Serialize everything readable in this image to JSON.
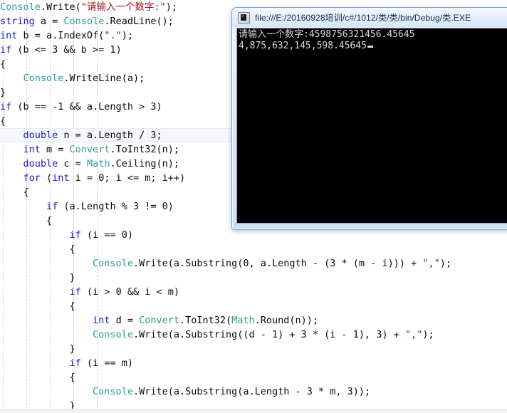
{
  "editor": {
    "name": "code-editor",
    "syntax_colors": {
      "keyword": "#1818d0",
      "type": "#2e9b9b",
      "string": "#a31515",
      "plain": "#0a0a0a",
      "current_line_bg": "#f6f7fa"
    },
    "current_line_index": 9,
    "indent_guide_x": [
      4,
      37,
      70,
      103,
      136
    ],
    "lines": [
      [
        {
          "t": "Console",
          "c": "type"
        },
        {
          "t": ".Write(",
          "c": "plain"
        },
        {
          "t": "\"请输入一个数字:\"",
          "c": "str"
        },
        {
          "t": ");",
          "c": "plain"
        }
      ],
      [
        {
          "t": "string",
          "c": "kw"
        },
        {
          "t": " a = ",
          "c": "plain"
        },
        {
          "t": "Console",
          "c": "type"
        },
        {
          "t": ".ReadLine();",
          "c": "plain"
        }
      ],
      [
        {
          "t": "int",
          "c": "kw"
        },
        {
          "t": " b = a.IndexOf(",
          "c": "plain"
        },
        {
          "t": "\".\"",
          "c": "str"
        },
        {
          "t": ");",
          "c": "plain"
        }
      ],
      [
        {
          "t": "if",
          "c": "kw"
        },
        {
          "t": " (b <= 3 && b >= 1)",
          "c": "plain"
        }
      ],
      [
        {
          "t": "{",
          "c": "plain"
        }
      ],
      [
        {
          "t": "    ",
          "c": "plain"
        },
        {
          "t": "Console",
          "c": "type"
        },
        {
          "t": ".WriteLine(a);",
          "c": "plain"
        }
      ],
      [
        {
          "t": "}",
          "c": "plain"
        }
      ],
      [
        {
          "t": "if",
          "c": "kw"
        },
        {
          "t": " (b == -1 && a.Length > 3)",
          "c": "plain"
        }
      ],
      [
        {
          "t": "{",
          "c": "plain"
        }
      ],
      [
        {
          "t": "    ",
          "c": "plain"
        },
        {
          "t": "double",
          "c": "kw"
        },
        {
          "t": " n = a.Length / 3;",
          "c": "plain"
        }
      ],
      [
        {
          "t": "    ",
          "c": "plain"
        },
        {
          "t": "int",
          "c": "kw"
        },
        {
          "t": " m = ",
          "c": "plain"
        },
        {
          "t": "Convert",
          "c": "type"
        },
        {
          "t": ".ToInt32(n);",
          "c": "plain"
        }
      ],
      [
        {
          "t": "    ",
          "c": "plain"
        },
        {
          "t": "double",
          "c": "kw"
        },
        {
          "t": " c = ",
          "c": "plain"
        },
        {
          "t": "Math",
          "c": "type"
        },
        {
          "t": ".Ceiling(n);",
          "c": "plain"
        }
      ],
      [
        {
          "t": "    ",
          "c": "plain"
        },
        {
          "t": "for",
          "c": "kw"
        },
        {
          "t": " (",
          "c": "plain"
        },
        {
          "t": "int",
          "c": "kw"
        },
        {
          "t": " i = 0; i <= m; i++)",
          "c": "plain"
        }
      ],
      [
        {
          "t": "    {",
          "c": "plain"
        }
      ],
      [
        {
          "t": "        ",
          "c": "plain"
        },
        {
          "t": "if",
          "c": "kw"
        },
        {
          "t": " (a.Length % 3 != 0)",
          "c": "plain"
        }
      ],
      [
        {
          "t": "        {",
          "c": "plain"
        }
      ],
      [
        {
          "t": "            ",
          "c": "plain"
        },
        {
          "t": "if",
          "c": "kw"
        },
        {
          "t": " (i == 0)",
          "c": "plain"
        }
      ],
      [
        {
          "t": "            {",
          "c": "plain"
        }
      ],
      [
        {
          "t": "                ",
          "c": "plain"
        },
        {
          "t": "Console",
          "c": "type"
        },
        {
          "t": ".Write(a.Substring(0, a.Length - (3 * (m - i))) + ",
          "c": "plain"
        },
        {
          "t": "\",\"",
          "c": "str"
        },
        {
          "t": ");",
          "c": "plain"
        }
      ],
      [
        {
          "t": "            }",
          "c": "plain"
        }
      ],
      [
        {
          "t": "            ",
          "c": "plain"
        },
        {
          "t": "if",
          "c": "kw"
        },
        {
          "t": " (i > 0 && i < m)",
          "c": "plain"
        }
      ],
      [
        {
          "t": "            {",
          "c": "plain"
        }
      ],
      [
        {
          "t": "                ",
          "c": "plain"
        },
        {
          "t": "int",
          "c": "kw"
        },
        {
          "t": " d = ",
          "c": "plain"
        },
        {
          "t": "Convert",
          "c": "type"
        },
        {
          "t": ".ToInt32(",
          "c": "plain"
        },
        {
          "t": "Math",
          "c": "type"
        },
        {
          "t": ".Round(n));",
          "c": "plain"
        }
      ],
      [
        {
          "t": "                ",
          "c": "plain"
        },
        {
          "t": "Console",
          "c": "type"
        },
        {
          "t": ".Write(a.Substring((d - 1) + 3 * (i - 1), 3) + ",
          "c": "plain"
        },
        {
          "t": "\",\"",
          "c": "str"
        },
        {
          "t": ");",
          "c": "plain"
        }
      ],
      [
        {
          "t": "            }",
          "c": "plain"
        }
      ],
      [
        {
          "t": "            ",
          "c": "plain"
        },
        {
          "t": "if",
          "c": "kw"
        },
        {
          "t": " (i == m)",
          "c": "plain"
        }
      ],
      [
        {
          "t": "            {",
          "c": "plain"
        }
      ],
      [
        {
          "t": "                ",
          "c": "plain"
        },
        {
          "t": "Console",
          "c": "type"
        },
        {
          "t": ".Write(a.Substring(a.Length - 3 * m, 3));",
          "c": "plain"
        }
      ],
      [
        {
          "t": "            }",
          "c": "plain"
        }
      ]
    ]
  },
  "console_window": {
    "name": "console-window",
    "title": "file:///E:/20160928培训/c#/1012/类/类/bin/Debug/类.EXE",
    "icon": "console-app-icon",
    "output_lines": [
      "请输入一个数字:4598756321456.45645",
      "4,875,632,145,598.45645"
    ],
    "caret_visible": true
  }
}
